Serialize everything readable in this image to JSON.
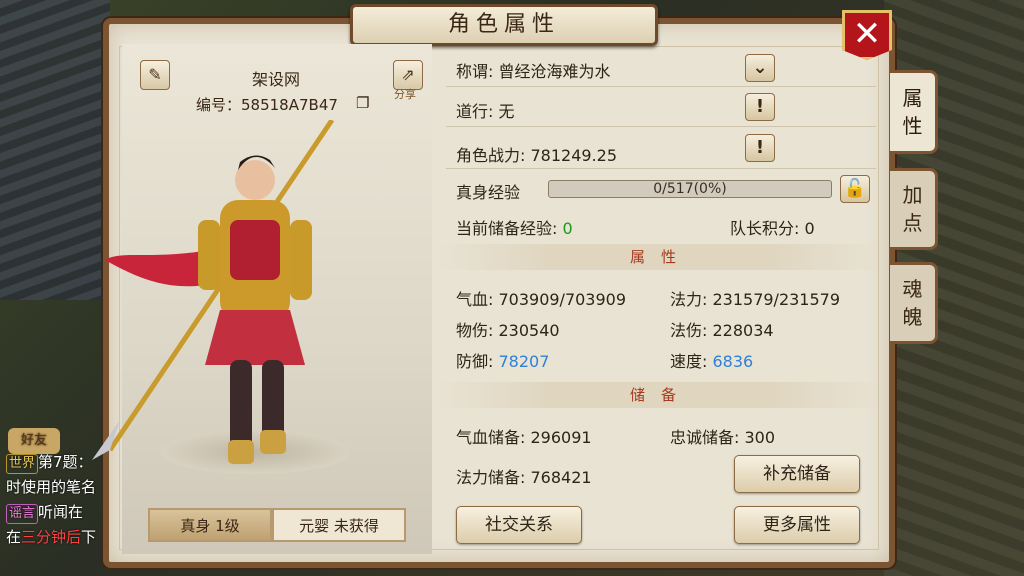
{
  "window": {
    "title": "角色属性"
  },
  "side_tabs": [
    {
      "label": "属\n性"
    },
    {
      "label": "加\n点"
    },
    {
      "label": "魂\n魄"
    }
  ],
  "character": {
    "name": "架设网",
    "id_label": "编号：58518A7B47",
    "share_label": "分享"
  },
  "forms": {
    "true_body": "真身 1级",
    "yuanying": "元婴 未获得"
  },
  "info": {
    "title_row": "称谓: 曾经沧海难为水",
    "daoxing_row": "道行: 无",
    "power_row": "角色战力: 781249.25",
    "exp_label": "真身经验",
    "exp_value": "0/517(0%)",
    "exp_progress": 0,
    "stored_exp_label": "当前储备经验:",
    "stored_exp_value": "0",
    "captain_points": "队长积分: 0"
  },
  "attributes": {
    "header": "属性",
    "hp": "气血: 703909/703909",
    "mp": "法力: 231579/231579",
    "phys_dmg": "物伤: 230540",
    "mag_dmg": "法伤: 228034",
    "defense_label": "防御:",
    "defense_value": "78207",
    "speed_label": "速度:",
    "speed_value": "6836"
  },
  "reserves": {
    "header": "储备",
    "hp_reserve": "气血储备: 296091",
    "loyalty_reserve": "忠诚储备: 300",
    "mp_reserve": "法力储备: 768421",
    "replenish_button": "补充储备"
  },
  "buttons": {
    "social": "社交关系",
    "more_attrs": "更多属性"
  },
  "chat": {
    "friend_label": "好友",
    "world_tag": "世界",
    "line1": "第7题：",
    "line2": "时使用的笔名",
    "rumor_tag": "谣言",
    "line3": "听闻在",
    "line4_prefix": "在",
    "line4_red": "三分钟后",
    "line4_suffix": "下"
  },
  "colors": {
    "panel_border": "#7b5432",
    "close_red": "#b3151a",
    "section_title": "#a53a1e",
    "value_green": "#1a9a1a",
    "value_blue": "#2f80d8"
  }
}
